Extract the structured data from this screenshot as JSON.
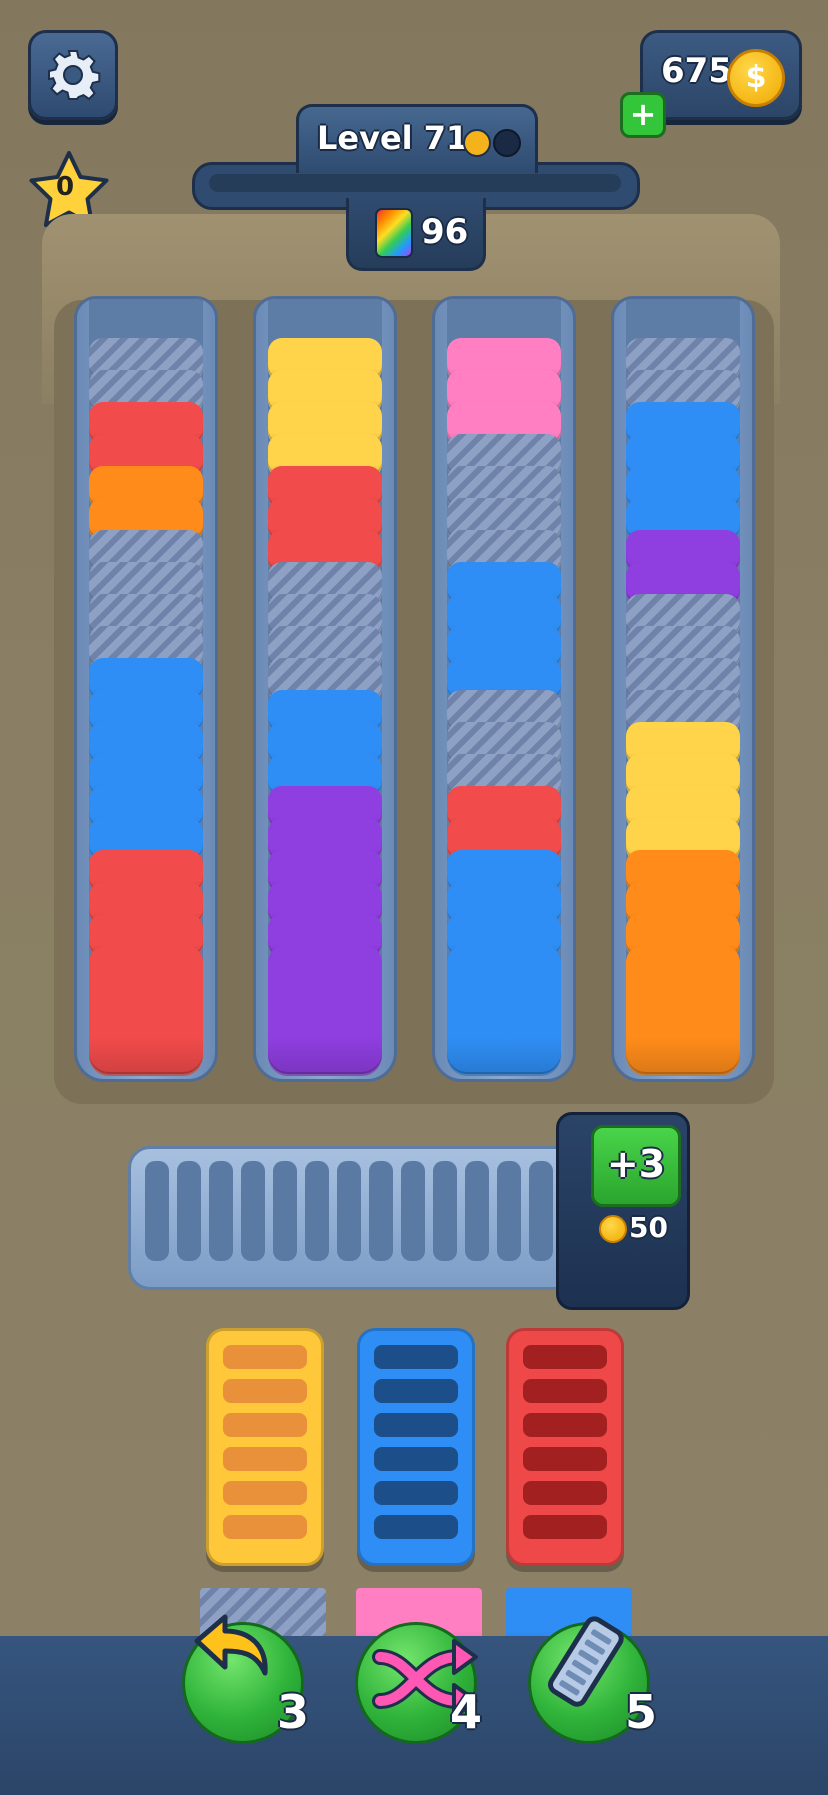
{
  "header": {
    "coins": "675",
    "coin_symbol": "$",
    "plus_label": "+",
    "stars": "0",
    "level_label": "Level 71",
    "counter": "96"
  },
  "colors": {
    "red": "#f24b4b",
    "orange": "#ff8c1a",
    "yellow": "#ffd34a",
    "pink": "#ff7fc2",
    "blue": "#2f8ef5",
    "purple": "#8f3ee0",
    "hidden": "#7e92b8"
  },
  "tubes": [
    [
      "hidden",
      "hidden",
      "red",
      "red",
      "orange",
      "orange",
      "hidden",
      "hidden",
      "hidden",
      "hidden",
      "blue",
      "blue",
      "blue",
      "blue",
      "blue",
      "blue",
      "red",
      "red",
      "red",
      "red"
    ],
    [
      "yellow",
      "yellow",
      "yellow",
      "yellow",
      "red",
      "red",
      "red",
      "hidden",
      "hidden",
      "hidden",
      "hidden",
      "blue",
      "blue",
      "blue",
      "purple",
      "purple",
      "purple",
      "purple",
      "purple",
      "purple"
    ],
    [
      "pink",
      "pink",
      "pink",
      "hidden",
      "hidden",
      "hidden",
      "hidden",
      "blue",
      "blue",
      "blue",
      "blue",
      "hidden",
      "hidden",
      "hidden",
      "red",
      "red",
      "blue",
      "blue",
      "blue",
      "blue"
    ],
    [
      "hidden",
      "hidden",
      "blue",
      "blue",
      "blue",
      "blue",
      "purple",
      "purple",
      "hidden",
      "hidden",
      "hidden",
      "hidden",
      "yellow",
      "yellow",
      "yellow",
      "yellow",
      "orange",
      "orange",
      "orange",
      "orange"
    ]
  ],
  "tray": {
    "slot_count": 13,
    "extend_label": "+3",
    "extend_price": "50"
  },
  "holders": [
    {
      "color": "yellow",
      "fill": "#ffc83a",
      "rung": "#e8903a"
    },
    {
      "color": "blue",
      "fill": "#2f8ef5",
      "rung": "#1c4f8a"
    },
    {
      "color": "red",
      "fill": "#ef4848",
      "rung": "#a32020"
    }
  ],
  "peek": [
    "hidden",
    "pink",
    "blue"
  ],
  "powerups": [
    {
      "name": "undo",
      "count": "3"
    },
    {
      "name": "shuffle",
      "count": "4"
    },
    {
      "name": "extra-tray",
      "count": "5"
    }
  ]
}
